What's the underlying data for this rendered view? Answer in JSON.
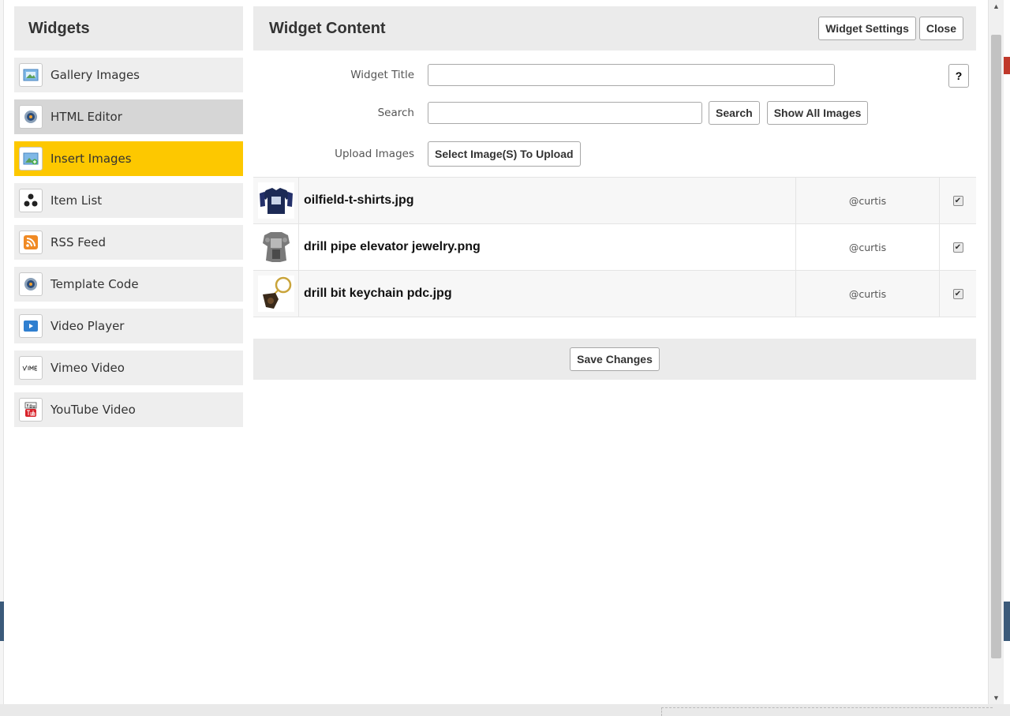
{
  "sidebar": {
    "title": "Widgets",
    "items": [
      {
        "label": "Gallery Images",
        "icon": "gallery-images-icon"
      },
      {
        "label": "HTML Editor",
        "icon": "html-editor-gear-icon"
      },
      {
        "label": "Insert Images",
        "icon": "insert-images-icon"
      },
      {
        "label": "Item List",
        "icon": "item-list-icon"
      },
      {
        "label": "RSS Feed",
        "icon": "rss-feed-icon"
      },
      {
        "label": "Template Code",
        "icon": "template-code-gear-icon"
      },
      {
        "label": "Video Player",
        "icon": "video-player-icon"
      },
      {
        "label": "Vimeo Video",
        "icon": "vimeo-icon"
      },
      {
        "label": "YouTube Video",
        "icon": "youtube-icon"
      }
    ],
    "active_index": 2,
    "highlight_index": 1
  },
  "main": {
    "title": "Widget Content",
    "settings_label": "Widget Settings",
    "close_label": "Close",
    "help_label": "?",
    "form": {
      "widget_title_label": "Widget Title",
      "widget_title_value": "",
      "search_label": "Search",
      "search_value": "",
      "search_button": "Search",
      "show_all_button": "Show All Images",
      "upload_label": "Upload Images",
      "upload_button": "Select Image(S) To Upload"
    },
    "images": [
      {
        "name": "oilfield-t-shirts.jpg",
        "user": "@curtis",
        "checked": true,
        "thumb": "t-shirt-thumbnail"
      },
      {
        "name": "drill pipe elevator jewelry.png",
        "user": "@curtis",
        "checked": true,
        "thumb": "elevator-jewelry-thumbnail"
      },
      {
        "name": "drill bit keychain pdc.jpg",
        "user": "@curtis",
        "checked": true,
        "thumb": "keychain-thumbnail"
      }
    ],
    "save_label": "Save Changes"
  },
  "colors": {
    "active_item": "#fdc800",
    "panel_header": "#ebebeb",
    "highlight_item": "#d6d6d6"
  }
}
